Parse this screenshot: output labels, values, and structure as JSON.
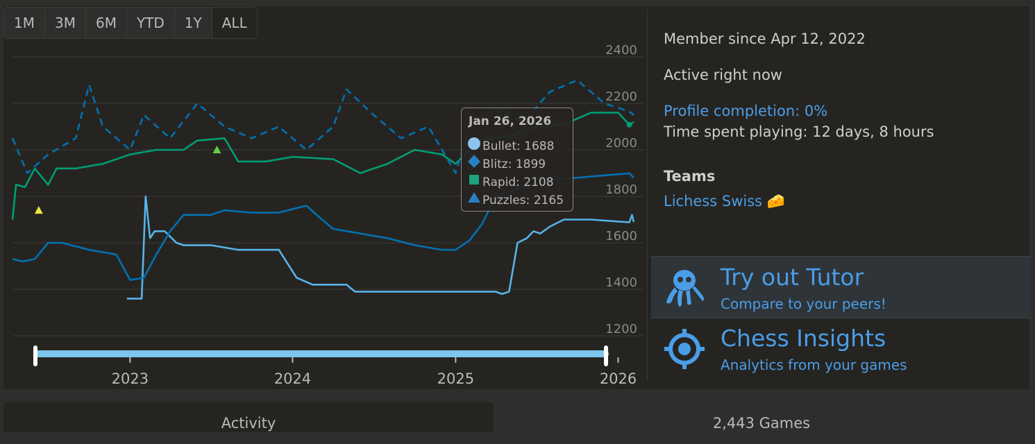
{
  "range_buttons": [
    "1M",
    "3M",
    "6M",
    "YTD",
    "1Y",
    "ALL"
  ],
  "chart_data": {
    "type": "line",
    "xlabel": "",
    "ylabel": "",
    "x_ticks": [
      "2023",
      "2024",
      "2025",
      "2026"
    ],
    "y_ticks": [
      "2400",
      "2200",
      "2000",
      "1800",
      "1600",
      "1400",
      "1200"
    ],
    "ylim": [
      1200,
      2400
    ],
    "xlim": [
      "2022-04-12",
      "2026-02-05"
    ],
    "grid": true,
    "colors": {
      "bullet": "#56b4e9",
      "blitz": "#0072b2",
      "rapid": "#009e73",
      "puzzles": "#0072b2",
      "marker_yellow": "#f0e442",
      "marker_green": "#66cc44"
    },
    "series": [
      {
        "name": "Bullet",
        "color": "#56b4e9",
        "points": [
          [
            "2022-12-25",
            1360
          ],
          [
            "2023-01-27",
            1360
          ],
          [
            "2023-02-05",
            1800
          ],
          [
            "2023-02-15",
            1620
          ],
          [
            "2023-02-25",
            1650
          ],
          [
            "2023-03-20",
            1650
          ],
          [
            "2023-04-15",
            1600
          ],
          [
            "2023-05-01",
            1590
          ],
          [
            "2023-07-01",
            1590
          ],
          [
            "2023-09-01",
            1570
          ],
          [
            "2023-12-01",
            1570
          ],
          [
            "2024-01-10",
            1450
          ],
          [
            "2024-02-15",
            1420
          ],
          [
            "2024-05-01",
            1420
          ],
          [
            "2024-05-20",
            1390
          ],
          [
            "2024-09-01",
            1390
          ],
          [
            "2025-02-01",
            1390
          ],
          [
            "2025-04-01",
            1390
          ],
          [
            "2025-04-15",
            1380
          ],
          [
            "2025-05-01",
            1390
          ],
          [
            "2025-05-20",
            1600
          ],
          [
            "2025-06-10",
            1620
          ],
          [
            "2025-06-25",
            1650
          ],
          [
            "2025-07-10",
            1640
          ],
          [
            "2025-08-01",
            1670
          ],
          [
            "2025-09-01",
            1700
          ],
          [
            "2025-11-01",
            1700
          ],
          [
            "2026-01-26",
            1688
          ],
          [
            "2026-02-01",
            1720
          ],
          [
            "2026-02-05",
            1690
          ]
        ]
      },
      {
        "name": "Blitz",
        "color": "#0072b2",
        "points": [
          [
            "2022-04-12",
            1530
          ],
          [
            "2022-05-05",
            1520
          ],
          [
            "2022-06-01",
            1530
          ],
          [
            "2022-07-01",
            1600
          ],
          [
            "2022-08-01",
            1600
          ],
          [
            "2022-10-01",
            1570
          ],
          [
            "2022-12-01",
            1550
          ],
          [
            "2023-01-01",
            1440
          ],
          [
            "2023-02-01",
            1450
          ],
          [
            "2023-03-01",
            1550
          ],
          [
            "2023-04-01",
            1650
          ],
          [
            "2023-05-01",
            1720
          ],
          [
            "2023-07-01",
            1720
          ],
          [
            "2023-08-01",
            1740
          ],
          [
            "2023-10-01",
            1730
          ],
          [
            "2023-12-01",
            1730
          ],
          [
            "2024-02-01",
            1760
          ],
          [
            "2024-03-01",
            1710
          ],
          [
            "2024-04-01",
            1660
          ],
          [
            "2024-06-01",
            1640
          ],
          [
            "2024-08-01",
            1620
          ],
          [
            "2024-10-01",
            1590
          ],
          [
            "2024-12-01",
            1570
          ],
          [
            "2025-01-01",
            1570
          ],
          [
            "2025-02-01",
            1610
          ],
          [
            "2025-03-01",
            1680
          ],
          [
            "2025-04-01",
            1800
          ],
          [
            "2025-06-01",
            1840
          ],
          [
            "2025-08-01",
            1870
          ],
          [
            "2025-10-01",
            1880
          ],
          [
            "2025-12-01",
            1890
          ],
          [
            "2026-01-26",
            1899
          ],
          [
            "2026-02-05",
            1880
          ]
        ]
      },
      {
        "name": "Rapid",
        "color": "#009e73",
        "points": [
          [
            "2022-04-12",
            1700
          ],
          [
            "2022-04-20",
            1850
          ],
          [
            "2022-05-10",
            1840
          ],
          [
            "2022-06-01",
            1920
          ],
          [
            "2022-07-01",
            1850
          ],
          [
            "2022-07-20",
            1920
          ],
          [
            "2022-09-01",
            1920
          ],
          [
            "2022-11-01",
            1940
          ],
          [
            "2023-01-01",
            1980
          ],
          [
            "2023-03-01",
            2000
          ],
          [
            "2023-05-01",
            2000
          ],
          [
            "2023-06-01",
            2040
          ],
          [
            "2023-08-01",
            2050
          ],
          [
            "2023-09-01",
            1950
          ],
          [
            "2023-11-01",
            1950
          ],
          [
            "2024-01-01",
            1970
          ],
          [
            "2024-04-01",
            1960
          ],
          [
            "2024-06-01",
            1900
          ],
          [
            "2024-08-01",
            1940
          ],
          [
            "2024-10-01",
            2000
          ],
          [
            "2024-12-01",
            1980
          ],
          [
            "2025-01-01",
            1940
          ],
          [
            "2025-02-01",
            2000
          ],
          [
            "2025-03-01",
            2040
          ],
          [
            "2025-05-01",
            2060
          ],
          [
            "2025-07-01",
            2100
          ],
          [
            "2025-09-01",
            2110
          ],
          [
            "2025-11-01",
            2160
          ],
          [
            "2026-01-01",
            2160
          ],
          [
            "2026-01-26",
            2108
          ],
          [
            "2026-02-05",
            2120
          ]
        ]
      },
      {
        "name": "Puzzles",
        "color": "#0072b2",
        "dashed": true,
        "points": [
          [
            "2022-04-12",
            2050
          ],
          [
            "2022-05-15",
            1900
          ],
          [
            "2022-07-01",
            1980
          ],
          [
            "2022-09-01",
            2050
          ],
          [
            "2022-10-01",
            2280
          ],
          [
            "2022-11-01",
            2100
          ],
          [
            "2023-01-01",
            2000
          ],
          [
            "2023-02-01",
            2150
          ],
          [
            "2023-04-01",
            2050
          ],
          [
            "2023-06-01",
            2200
          ],
          [
            "2023-08-01",
            2100
          ],
          [
            "2023-10-01",
            2050
          ],
          [
            "2023-12-01",
            2100
          ],
          [
            "2024-02-01",
            2000
          ],
          [
            "2024-04-01",
            2100
          ],
          [
            "2024-05-01",
            2260
          ],
          [
            "2024-07-01",
            2150
          ],
          [
            "2024-09-01",
            2050
          ],
          [
            "2024-11-01",
            2100
          ],
          [
            "2025-01-01",
            1900
          ],
          [
            "2025-02-01",
            2100
          ],
          [
            "2025-04-01",
            2180
          ],
          [
            "2025-06-01",
            2120
          ],
          [
            "2025-08-01",
            2250
          ],
          [
            "2025-10-01",
            2300
          ],
          [
            "2025-12-01",
            2200
          ],
          [
            "2026-01-26",
            2165
          ],
          [
            "2026-02-05",
            2150
          ]
        ]
      }
    ],
    "markers": [
      {
        "type": "triangle",
        "color": "#f0e442",
        "x": "2022-06-10",
        "y": 1740
      },
      {
        "type": "triangle",
        "color": "#66cc44",
        "x": "2023-07-15",
        "y": 2000
      }
    ],
    "navigator_range": [
      "2022-04-12",
      "2026-02-05"
    ],
    "tooltip": {
      "date": "Jan 26, 2026",
      "rows": [
        {
          "icon": "circle-icon",
          "color": "#56b4e9",
          "text": "Bullet: 1688"
        },
        {
          "icon": "diamond-icon",
          "color": "#0072b2",
          "text": "Blitz: 1899"
        },
        {
          "icon": "square-icon",
          "color": "#009e73",
          "text": "Rapid: 2108"
        },
        {
          "icon": "triangle-icon",
          "color": "#0072b2",
          "text": "Puzzles: 2165"
        }
      ]
    }
  },
  "profile": {
    "member_since": "Member since Apr 12, 2022",
    "active": "Active right now",
    "completion": "Profile completion: 0%",
    "time_spent": "Time spent playing: 12 days, 8 hours",
    "teams_heading": "Teams",
    "team_name": "Lichess Swiss 🧀"
  },
  "promos": [
    {
      "title": "Try out Tutor",
      "subtitle": "Compare to your peers!",
      "icon": "octopus-icon"
    },
    {
      "title": "Chess Insights",
      "subtitle": "Analytics from your games",
      "icon": "target-icon"
    }
  ],
  "bottom_tabs": {
    "activity": "Activity",
    "games": "2,443 Games"
  }
}
